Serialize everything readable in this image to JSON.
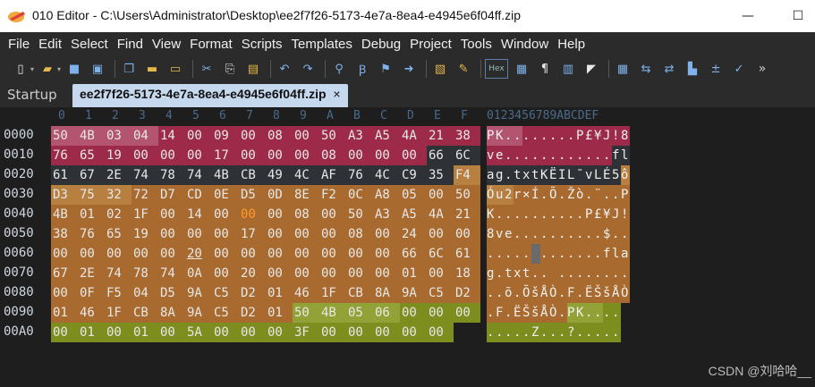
{
  "window": {
    "title": "010 Editor - C:\\Users\\Administrator\\Desktop\\ee2f7f26-5173-4e7a-8ea4-e4945e6f04ff.zip",
    "minimize": "—",
    "maximize": "☐"
  },
  "menu": [
    "File",
    "Edit",
    "Select",
    "Find",
    "View",
    "Format",
    "Scripts",
    "Templates",
    "Debug",
    "Project",
    "Tools",
    "Window",
    "Help"
  ],
  "toolbar_icons": [
    "new-file-icon",
    "open-folder-icon",
    "save-icon",
    "save-all-icon",
    "copy-files-icon",
    "folder-icon",
    "folder-open-icon",
    "cut-icon",
    "copy-icon",
    "paste-icon",
    "undo-icon",
    "redo-icon",
    "find-icon",
    "replace-icon",
    "find-files-icon",
    "goto-icon",
    "bookmark-icon",
    "highlight-icon",
    "hex-mode-icon",
    "chars-icon",
    "paragraph-icon",
    "columns-icon",
    "eraser-icon",
    "calculator-icon",
    "compare-icon",
    "swap-icon",
    "histogram-icon",
    "checksum-icon",
    "template-run-icon",
    "more-icon"
  ],
  "toolbar": {
    "hex_label": "Hex",
    "more_label": "»"
  },
  "tabs": {
    "startup": "Startup",
    "file": "ee2f7f26-5173-4e7a-8ea4-e4945e6f04ff.zip",
    "close": "×"
  },
  "hex": {
    "column_headers": [
      "0",
      "1",
      "2",
      "3",
      "4",
      "5",
      "6",
      "7",
      "8",
      "9",
      "A",
      "B",
      "C",
      "D",
      "E",
      "F"
    ],
    "ascii_header": "0123456789ABCDEF",
    "rows": [
      {
        "addr": "0000",
        "bytes": [
          "50",
          "4B",
          "03",
          "04",
          "14",
          "00",
          "09",
          "00",
          "08",
          "00",
          "50",
          "A3",
          "A5",
          "4A",
          "21",
          "38"
        ],
        "ascii": "PK........P£¥J!8"
      },
      {
        "addr": "0010",
        "bytes": [
          "76",
          "65",
          "19",
          "00",
          "00",
          "00",
          "17",
          "00",
          "00",
          "00",
          "08",
          "00",
          "00",
          "00",
          "66",
          "6C"
        ],
        "ascii": "ve............fl"
      },
      {
        "addr": "0020",
        "bytes": [
          "61",
          "67",
          "2E",
          "74",
          "78",
          "74",
          "4B",
          "CB",
          "49",
          "4C",
          "AF",
          "76",
          "4C",
          "C9",
          "35",
          "F4"
        ],
        "ascii": "ag.txtKËIL¯vLÉ5ô"
      },
      {
        "addr": "0030",
        "bytes": [
          "D3",
          "75",
          "32",
          "72",
          "D7",
          "CD",
          "0E",
          "D5",
          "0D",
          "8E",
          "F2",
          "0C",
          "A8",
          "05",
          "00",
          "50"
        ],
        "ascii": "Óu2r×Í.Õ.Žò.¨..P"
      },
      {
        "addr": "0040",
        "bytes": [
          "4B",
          "01",
          "02",
          "1F",
          "00",
          "14",
          "00",
          "00",
          "00",
          "08",
          "00",
          "50",
          "A3",
          "A5",
          "4A",
          "21"
        ],
        "ascii": "K..........P£¥J!"
      },
      {
        "addr": "0050",
        "bytes": [
          "38",
          "76",
          "65",
          "19",
          "00",
          "00",
          "00",
          "17",
          "00",
          "00",
          "00",
          "08",
          "00",
          "24",
          "00",
          "00"
        ],
        "ascii": "8ve..........$.."
      },
      {
        "addr": "0060",
        "bytes": [
          "00",
          "00",
          "00",
          "00",
          "00",
          "20",
          "00",
          "00",
          "00",
          "00",
          "00",
          "00",
          "00",
          "66",
          "6C",
          "61"
        ],
        "ascii": "..... .......fla"
      },
      {
        "addr": "0070",
        "bytes": [
          "67",
          "2E",
          "74",
          "78",
          "74",
          "0A",
          "00",
          "20",
          "00",
          "00",
          "00",
          "00",
          "00",
          "01",
          "00",
          "18"
        ],
        "ascii": "g.txt.. ........"
      },
      {
        "addr": "0080",
        "bytes": [
          "00",
          "0F",
          "F5",
          "04",
          "D5",
          "9A",
          "C5",
          "D2",
          "01",
          "46",
          "1F",
          "CB",
          "8A",
          "9A",
          "C5",
          "D2"
        ],
        "ascii": "..õ.ÕšÅÒ.F.ËŠšÅÒ"
      },
      {
        "addr": "0090",
        "bytes": [
          "01",
          "46",
          "1F",
          "CB",
          "8A",
          "9A",
          "C5",
          "D2",
          "01",
          "50",
          "4B",
          "05",
          "06",
          "00",
          "00",
          "00"
        ],
        "ascii": ".F.ËŠšÅÒ.PK...."
      },
      {
        "addr": "00A0",
        "bytes": [
          "00",
          "01",
          "00",
          "01",
          "00",
          "5A",
          "00",
          "00",
          "00",
          "3F",
          "00",
          "00",
          "00",
          "00",
          "00"
        ],
        "ascii": ".....Z...?....."
      }
    ],
    "colors": {
      "header_pink": "#9e2a4a",
      "header_pink_light": "#b35470",
      "data_dark": "#2e3236",
      "central_orange": "#a86a2e",
      "central_orange_light": "#b88040",
      "end_green": "#7d8d1e",
      "end_green_light": "#93a237"
    }
  },
  "watermark": "CSDN @刘哈哈__"
}
